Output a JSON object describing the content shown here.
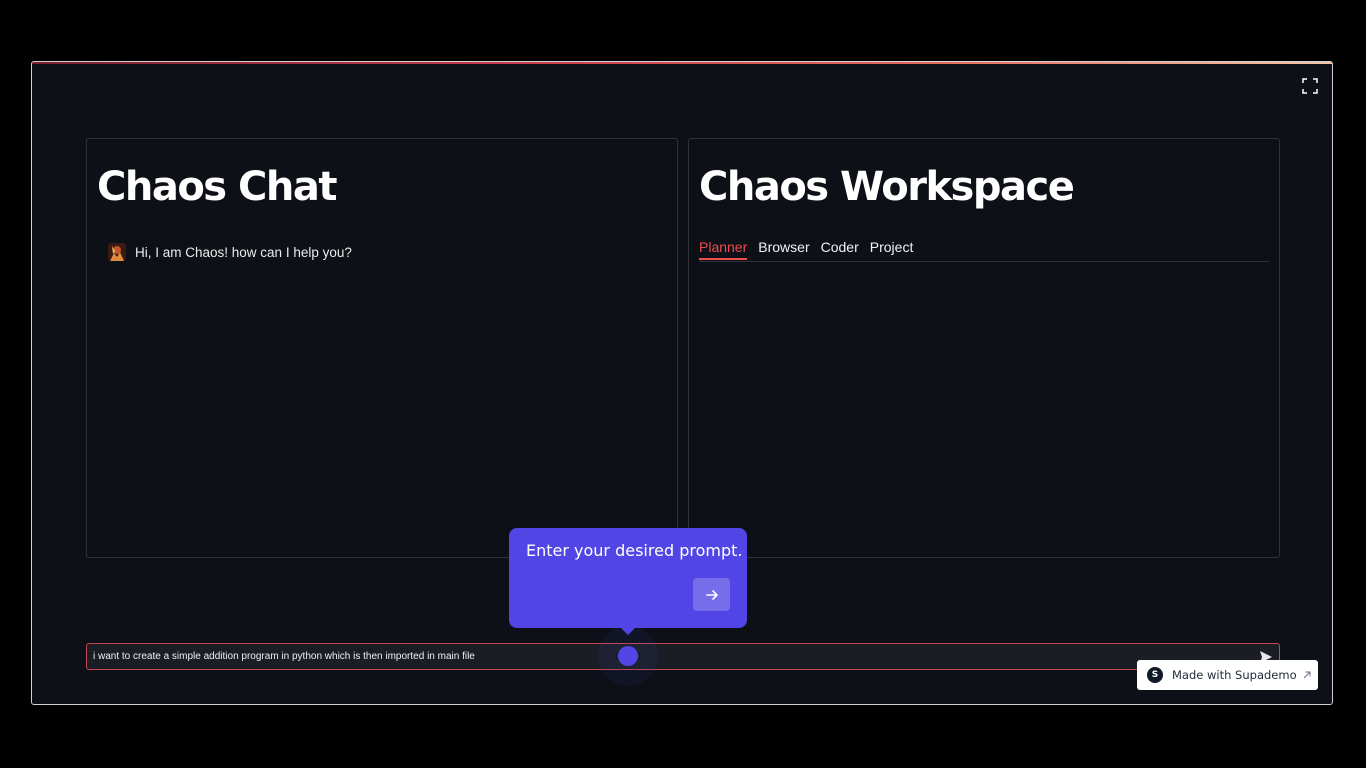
{
  "chat": {
    "title": "Chaos Chat",
    "message": "Hi, I am Chaos! how can I help you?",
    "avatar_icon": "chaos-avatar-icon"
  },
  "workspace": {
    "title": "Chaos Workspace",
    "tabs": [
      {
        "label": "Planner",
        "active": true
      },
      {
        "label": "Browser",
        "active": false
      },
      {
        "label": "Coder",
        "active": false
      },
      {
        "label": "Project",
        "active": false
      }
    ]
  },
  "prompt": {
    "value": "i want to create a simple addition program in python which is then imported in main file",
    "send_icon": "send-icon"
  },
  "tooltip": {
    "text": "Enter your desired prompt.",
    "next_icon": "arrow-right-icon"
  },
  "badge": {
    "label": "Made with Supademo",
    "logo": "S"
  },
  "colors": {
    "accent_red": "#ef4c4c",
    "tooltip_purple": "#5145e5",
    "background": "#0d1017"
  }
}
